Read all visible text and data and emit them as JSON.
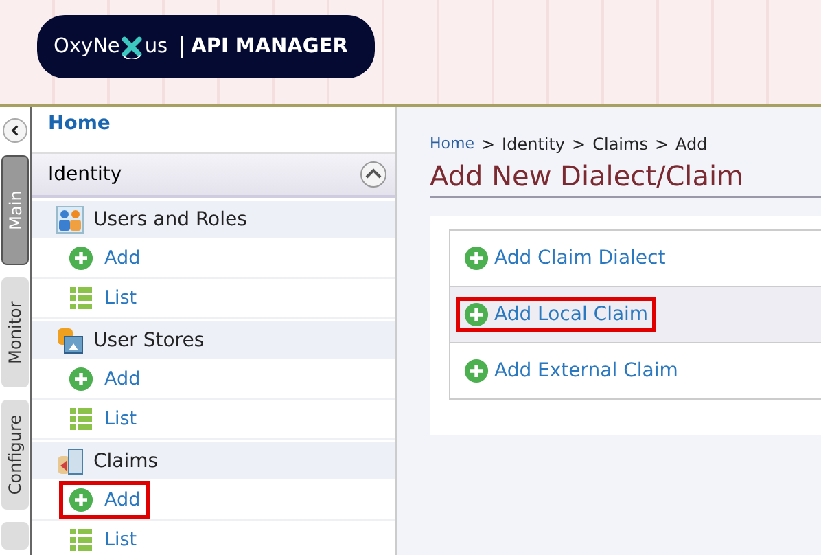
{
  "header": {
    "logo": {
      "left": "OxyNe",
      "right": "us"
    },
    "product": "API MANAGER"
  },
  "side_tabs": [
    {
      "label": "Main",
      "selected": true
    },
    {
      "label": "Monitor",
      "selected": false
    },
    {
      "label": "Configure",
      "selected": false
    },
    {
      "selected": false
    }
  ],
  "sidebar": {
    "home": "Home",
    "section": {
      "title": "Identity",
      "expanded": true
    },
    "groups": [
      {
        "title": "Users and Roles",
        "kind": "users",
        "children": [
          {
            "label": "Add",
            "kind": "add",
            "highlighted": false
          },
          {
            "label": "List",
            "kind": "list",
            "highlighted": false
          }
        ]
      },
      {
        "title": "User Stores",
        "kind": "stores",
        "children": [
          {
            "label": "Add",
            "kind": "add",
            "highlighted": false
          },
          {
            "label": "List",
            "kind": "list",
            "highlighted": false
          }
        ]
      },
      {
        "title": "Claims",
        "kind": "claims",
        "children": [
          {
            "label": "Add",
            "kind": "add",
            "highlighted": true
          },
          {
            "label": "List",
            "kind": "list",
            "highlighted": false
          }
        ]
      }
    ]
  },
  "breadcrumb": {
    "separator": ">",
    "items": [
      "Home",
      "Identity",
      "Claims",
      "Add"
    ]
  },
  "title": "Add New Dialect/Claim",
  "options": [
    {
      "label": "Add Claim Dialect",
      "highlighted": false,
      "selected": false
    },
    {
      "label": "Add Local Claim",
      "highlighted": true,
      "selected": true
    },
    {
      "label": "Add External Claim",
      "highlighted": false,
      "selected": false
    }
  ]
}
